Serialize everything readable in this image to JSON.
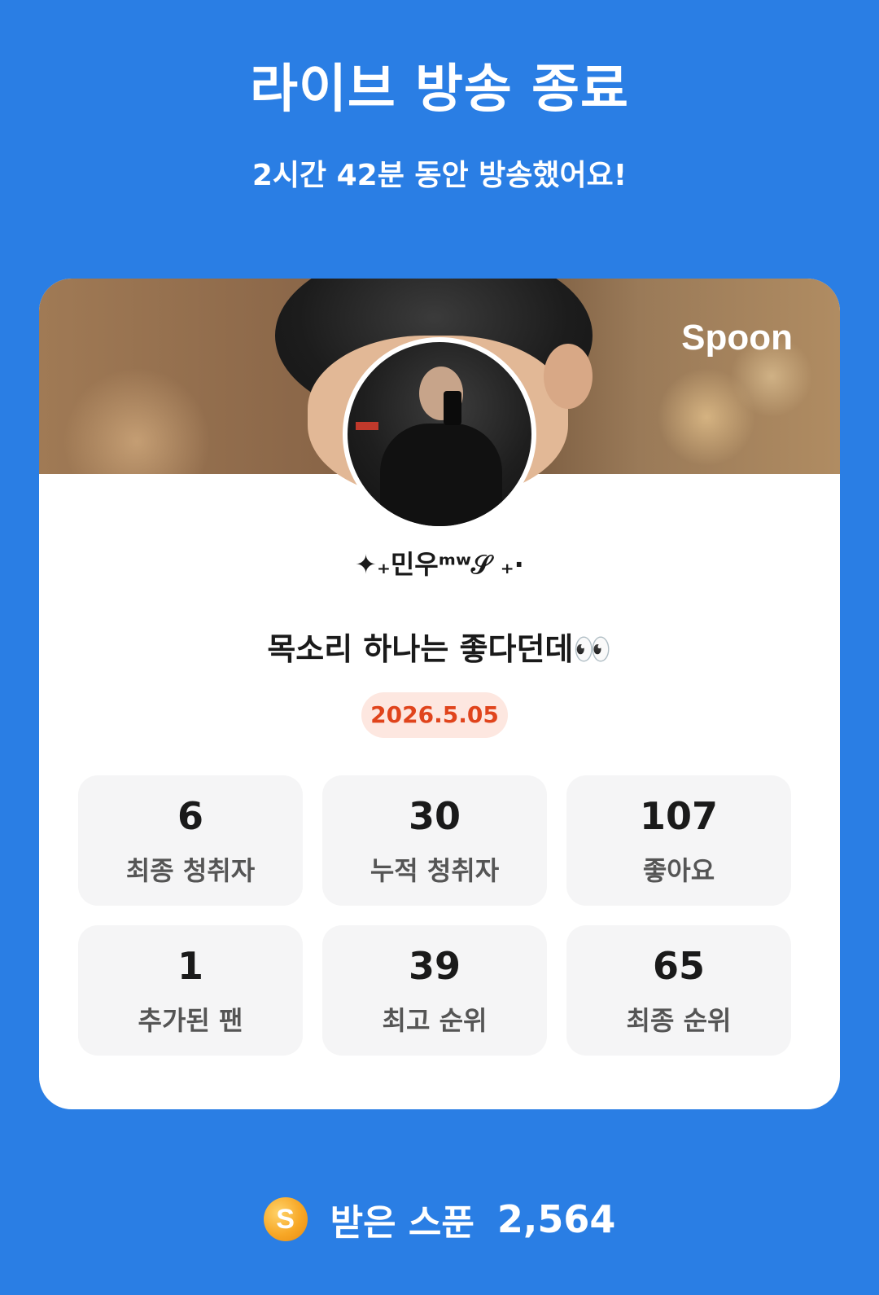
{
  "header": {
    "title": "라이브 방송 종료",
    "subtitle": "2시간 42분 동안 방송했어요!"
  },
  "card": {
    "brand": "Spoon",
    "nickname": "✦₊민우ᵐʷ𝒮 ₊·",
    "headline": "목소리 하나는 좋다던데👀",
    "date": "2026.5.05",
    "stats": [
      {
        "value": "6",
        "label": "최종 청취자"
      },
      {
        "value": "30",
        "label": "누적 청취자"
      },
      {
        "value": "107",
        "label": "좋아요"
      },
      {
        "value": "1",
        "label": "추가된 팬"
      },
      {
        "value": "39",
        "label": "최고 순위"
      },
      {
        "value": "65",
        "label": "최종 순위"
      }
    ]
  },
  "footer": {
    "coin_letter": "S",
    "label": "받은 스푼",
    "value": "2,564"
  },
  "colors": {
    "background": "#2a7ee4",
    "card": "#ffffff",
    "date_badge_bg": "#fde7e0",
    "date_badge_text": "#e0441c",
    "stat_bg": "#f5f5f6",
    "coin": "#f7a726"
  },
  "icons": {
    "coin": "spoon-coin-icon"
  }
}
